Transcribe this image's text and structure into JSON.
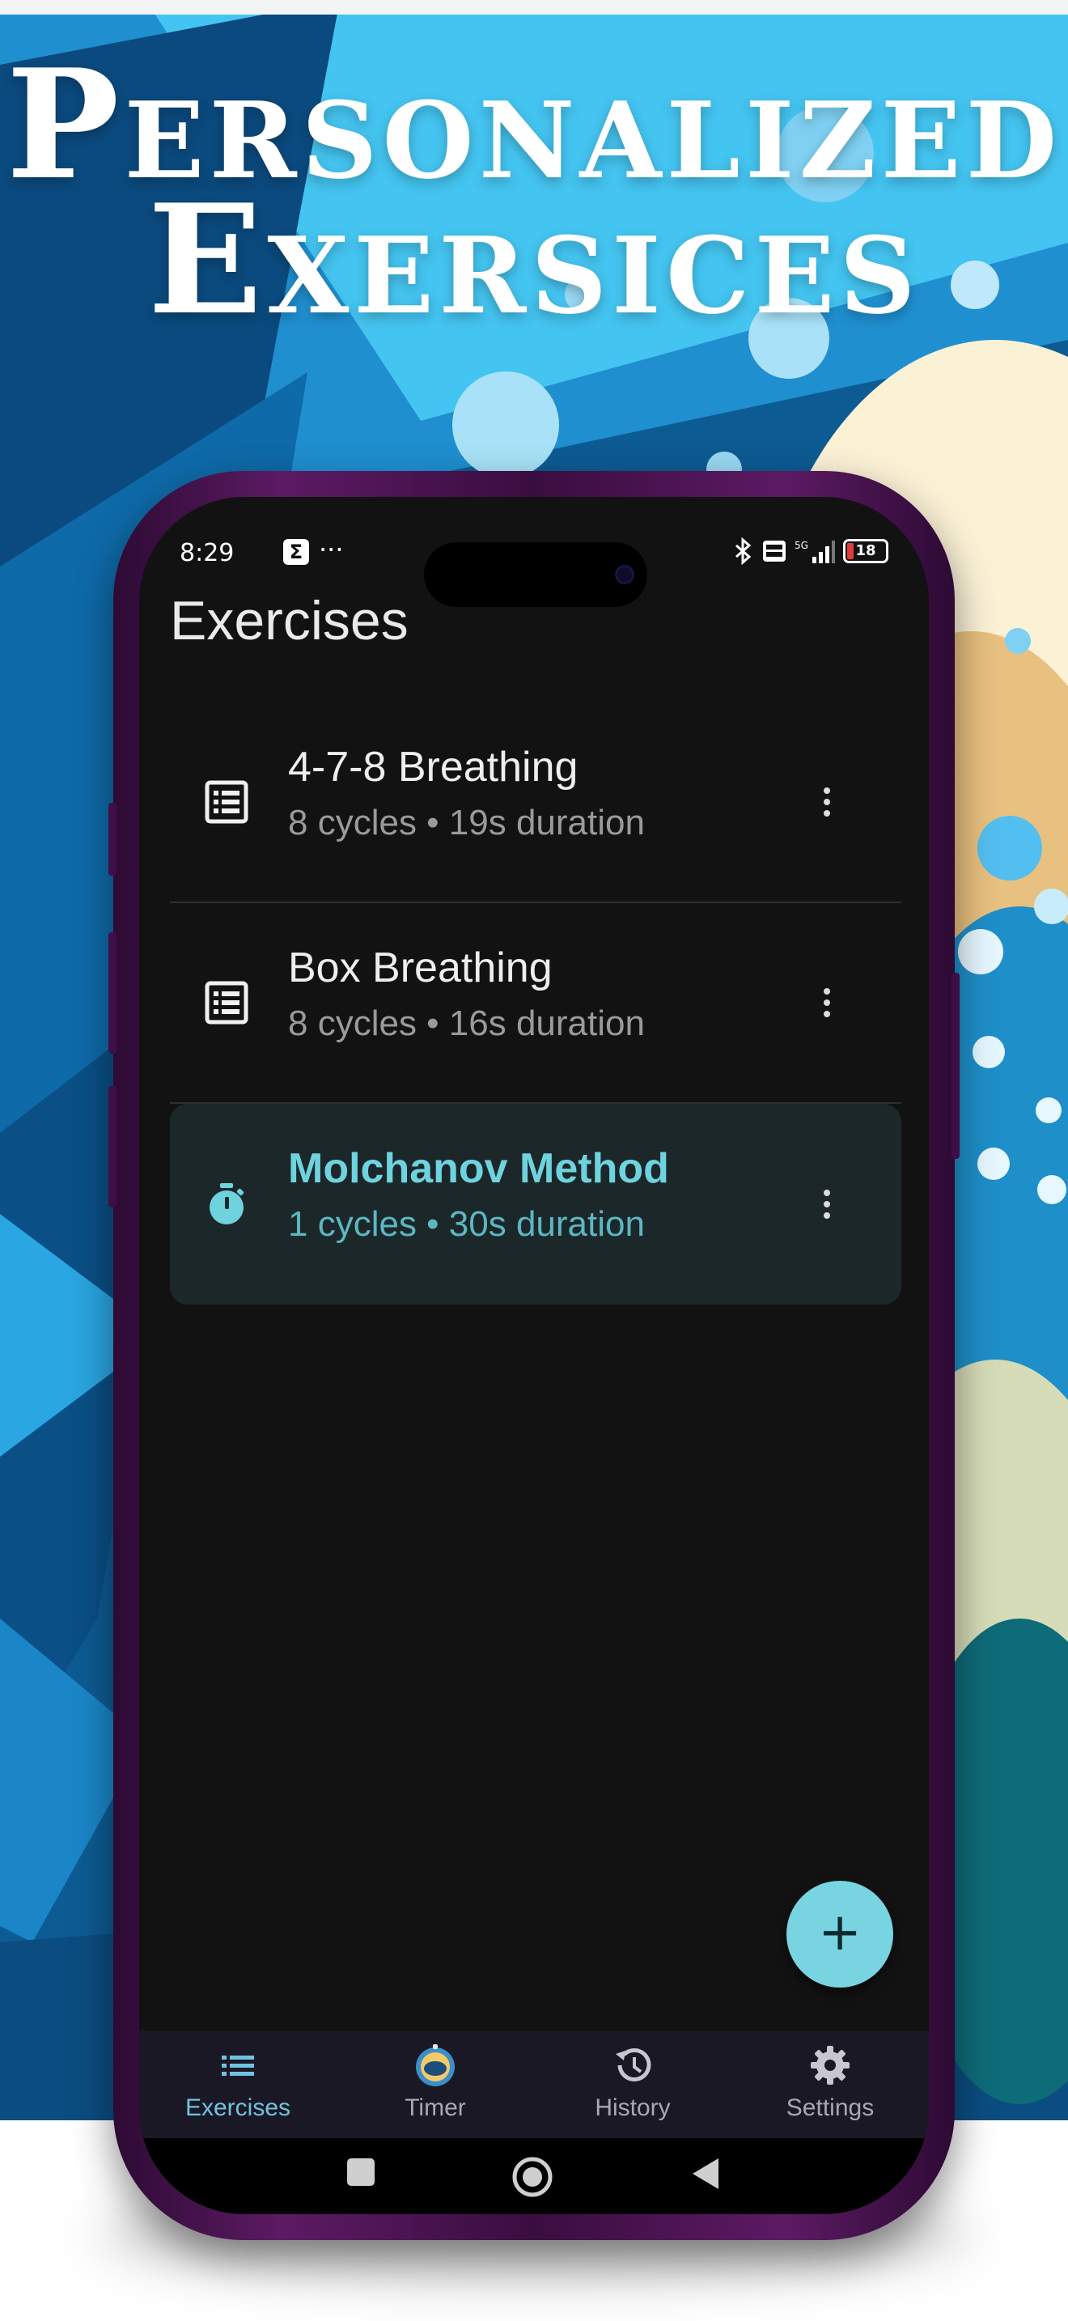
{
  "headline": {
    "line1": "Personalized",
    "line2": "Exersices"
  },
  "status_bar": {
    "time": "8:29",
    "sigma": "Σ",
    "more": "···",
    "battery": "18"
  },
  "app": {
    "title": "Exercises",
    "exercises": [
      {
        "name": "4-7-8 Breathing",
        "details": "8 cycles • 19s duration",
        "icon": "list-icon",
        "selected": false
      },
      {
        "name": "Box Breathing",
        "details": "8 cycles • 16s duration",
        "icon": "list-icon",
        "selected": false
      },
      {
        "name": "Molchanov Method",
        "details": "1 cycles • 30s duration",
        "icon": "stopwatch-icon",
        "selected": true
      }
    ],
    "fab_label": "+",
    "accent_color": "#78d4e1"
  },
  "bottom_nav": {
    "active": "Exercises",
    "tabs": [
      {
        "label": "Exercises",
        "icon": "list-icon"
      },
      {
        "label": "Timer",
        "icon": "timer-logo-icon"
      },
      {
        "label": "History",
        "icon": "history-icon"
      },
      {
        "label": "Settings",
        "icon": "gear-icon"
      }
    ]
  },
  "system_nav": {
    "buttons": [
      "recents-square-icon",
      "home-circle-icon",
      "back-triangle-icon"
    ]
  }
}
